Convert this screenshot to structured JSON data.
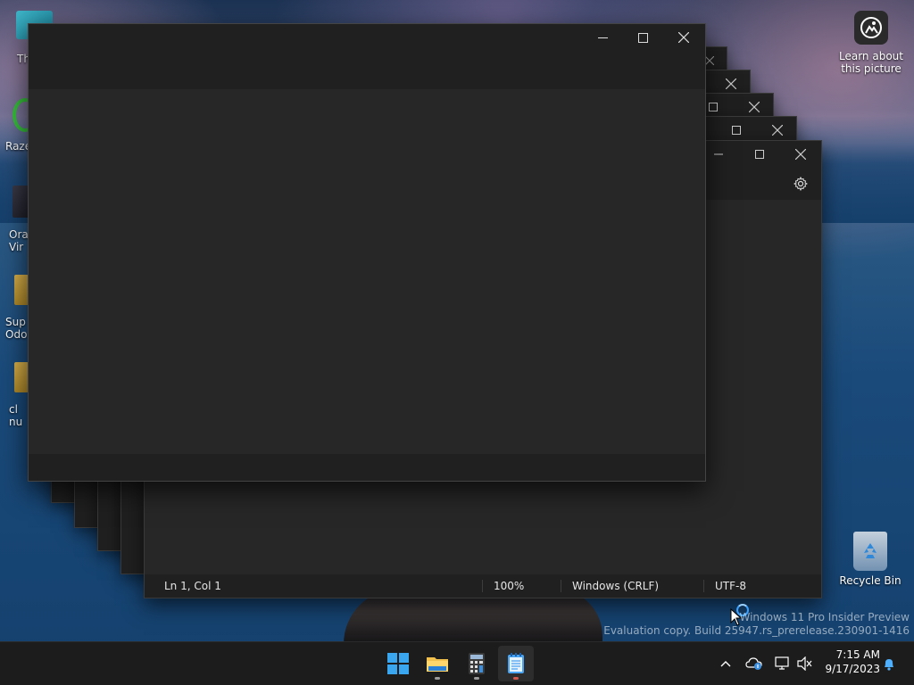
{
  "desktop": {
    "left_icons": [
      {
        "label": "Th",
        "icon": "this-pc-icon"
      },
      {
        "label": "Raze",
        "icon": "razer-icon"
      },
      {
        "label": "Ora\nVir",
        "icon": "virtualbox-icon"
      },
      {
        "label": "Sup\nOdo",
        "icon": "folder-icon"
      },
      {
        "label": "cl\nnu",
        "icon": "folder-icon"
      }
    ],
    "learn_picture": {
      "label": "Learn about this picture",
      "icon": "camera-pin-icon"
    },
    "recycle_bin": {
      "label": "Recycle Bin",
      "icon": "recycle-bin-icon"
    }
  },
  "notepad": {
    "settings_icon": "gear-icon",
    "status": {
      "position": "Ln 1, Col 1",
      "zoom": "100%",
      "line_ending": "Windows (CRLF)",
      "encoding": "UTF-8"
    }
  },
  "watermark": {
    "line1": "Windows 11 Pro Insider Preview",
    "line2": "Evaluation copy. Build 25947.rs_prerelease.230901-1416"
  },
  "taskbar": {
    "apps": [
      {
        "name": "Start",
        "icon": "windows-logo-icon"
      },
      {
        "name": "File Explorer",
        "icon": "folder-icon"
      },
      {
        "name": "Calculator",
        "icon": "calculator-icon"
      },
      {
        "name": "Notepad",
        "icon": "notepad-icon"
      }
    ],
    "tray": {
      "chevron": "chevron-up-icon",
      "onedrive": "onedrive-icon",
      "network": "network-icon",
      "volume": "volume-muted-icon",
      "notifications": "bell-icon"
    },
    "time": "7:15 AM",
    "date": "9/17/2023"
  },
  "colors": {
    "window_bg": "#272727",
    "titlebar_bg": "#202020",
    "taskbar_bg": "#1c1c1c",
    "accent_red": "#d0564c"
  }
}
